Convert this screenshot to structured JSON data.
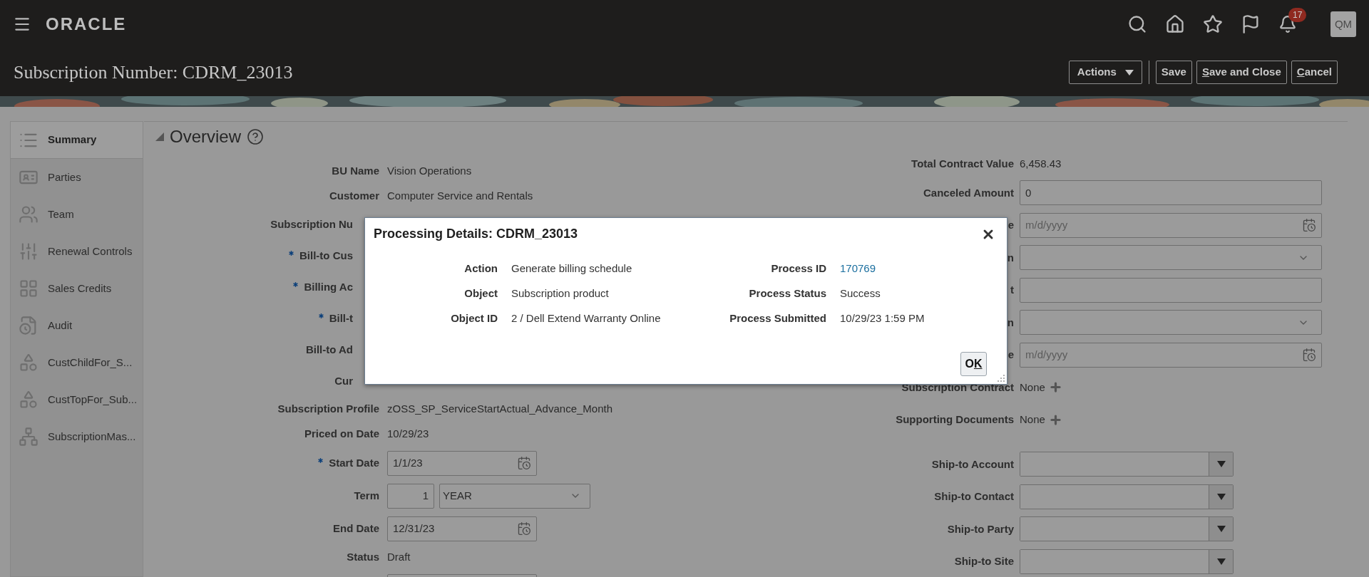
{
  "header": {
    "logo": "ORACLE",
    "notification_count": "17",
    "avatar": "QM"
  },
  "page_title": "Subscription Number: CDRM_23013",
  "actions": [
    {
      "kind": "menu",
      "label_after": "Actions"
    },
    {
      "kind": "button",
      "label_after": "Save"
    },
    {
      "kind": "button",
      "access_key": "S",
      "label_after": "ave and Close"
    },
    {
      "kind": "button",
      "access_key": "C",
      "label_after": "ancel"
    }
  ],
  "sidebar": {
    "items": [
      {
        "kind": "summary",
        "label": "Summary",
        "selected": true
      },
      {
        "kind": "parties",
        "label": "Parties",
        "selected": false
      },
      {
        "kind": "team",
        "label": "Team",
        "selected": false
      },
      {
        "kind": "controls",
        "label": "Renewal Controls",
        "selected": false
      },
      {
        "kind": "credits",
        "label": "Sales Credits",
        "selected": false
      },
      {
        "kind": "audit",
        "label": "Audit",
        "selected": false
      },
      {
        "kind": "shapes",
        "label": "CustChildFor_S...",
        "selected": false
      },
      {
        "kind": "shapes",
        "label": "CustTopFor_Sub...",
        "selected": false
      },
      {
        "kind": "tree",
        "label": "SubscriptionMas...",
        "selected": false
      }
    ]
  },
  "section": {
    "title": "Overview"
  },
  "left_fields": [
    {
      "kind": "text",
      "label": "BU Name",
      "required": false,
      "value": "Vision Operations"
    },
    {
      "kind": "text",
      "label": "Customer",
      "required": false,
      "value": "Computer Service and Rentals"
    },
    {
      "kind": "occluded",
      "label": "Subscription Nu",
      "required": false
    },
    {
      "kind": "occluded",
      "label": "Bill-to Cus",
      "required": true
    },
    {
      "kind": "occluded",
      "label": "Billing Ac",
      "required": true
    },
    {
      "kind": "occluded",
      "label": "Bill-t",
      "required": true
    },
    {
      "kind": "occluded",
      "label": "Bill-to Ad",
      "required": false
    },
    {
      "kind": "occluded",
      "label": "Cur",
      "required": false
    },
    {
      "kind": "text",
      "label": "Subscription Profile",
      "required": false,
      "value": "zOSS_SP_ServiceStartActual_Advance_Month"
    },
    {
      "kind": "text",
      "label": "Priced on Date",
      "required": false,
      "value": "10/29/23"
    },
    {
      "kind": "date",
      "label": "Start Date",
      "required": true,
      "value": "1/1/23"
    },
    {
      "kind": "term",
      "label": "Term",
      "required": false,
      "value": "1",
      "unit": "YEAR"
    },
    {
      "kind": "date",
      "label": "End Date",
      "required": false,
      "value": "12/31/23"
    },
    {
      "kind": "text",
      "label": "Status",
      "required": false,
      "value": "Draft"
    },
    {
      "kind": "field",
      "required": false
    }
  ],
  "right_fields": [
    {
      "kind": "text",
      "label": "Total Contract Value",
      "value": "6,458.43"
    },
    {
      "kind": "input",
      "label": "Canceled Amount",
      "value": "0"
    },
    {
      "kind": "date",
      "label": "e",
      "placeholder": "m/d/yyyy"
    },
    {
      "kind": "select",
      "label": "n"
    },
    {
      "kind": "input",
      "label": "t"
    },
    {
      "kind": "select",
      "label": "n"
    },
    {
      "kind": "date",
      "label": "e",
      "placeholder": "m/d/yyyy"
    },
    {
      "kind": "attach",
      "label": "Subscription Contract",
      "value": "None"
    },
    {
      "kind": "attach",
      "label": "Supporting Documents",
      "value": "None"
    }
  ],
  "shipping_fields": [
    {
      "label": "Ship-to Account"
    },
    {
      "label": "Ship-to Contact"
    },
    {
      "label": "Ship-to Party"
    },
    {
      "label": "Ship-to Site"
    }
  ],
  "dialog": {
    "title": "Processing Details: CDRM_23013",
    "left": [
      {
        "label": "Action",
        "value": "Generate billing schedule"
      },
      {
        "label": "Object",
        "value": "Subscription product"
      },
      {
        "label": "Object ID",
        "value": "2 / Dell Extend Warranty Online"
      }
    ],
    "right": [
      {
        "label": "Process ID",
        "value": "170769",
        "kind": "link"
      },
      {
        "label": "Process Status",
        "value": "Success",
        "kind": "text"
      },
      {
        "label": "Process Submitted",
        "value": "10/29/23 1:59 PM",
        "kind": "text"
      }
    ],
    "ok": {
      "label_before": "O",
      "access_key": "K"
    }
  }
}
